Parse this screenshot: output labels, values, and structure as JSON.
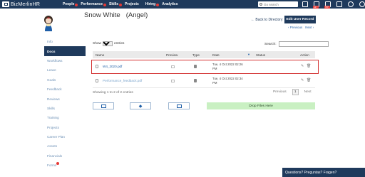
{
  "header": {
    "logo_text": "BizMerlinHR",
    "nav": [
      {
        "label": "People",
        "badge": true
      },
      {
        "label": "Performance",
        "badge": true
      },
      {
        "label": "Skills",
        "badge": true
      },
      {
        "label": "Projects",
        "badge": false
      },
      {
        "label": "Hiring",
        "badge": true
      },
      {
        "label": "Analytics",
        "badge": false
      }
    ],
    "search_placeholder": "Go search",
    "icons": [
      "mail-icon",
      "calendar-icon",
      "tasks-icon",
      "star-icon",
      "help-icon",
      "settings-icon",
      "user-icon"
    ],
    "badges": {
      "calendar": "11+",
      "tasks": "99+"
    }
  },
  "profile": {
    "name": "Snow White",
    "alias": "(Angel)",
    "back_link": "← Back to Directory",
    "edit_button": "Edit User Record",
    "prev": "‹ Previous",
    "next": "Next ›"
  },
  "sidebar": {
    "items": [
      {
        "label": "Info"
      },
      {
        "label": "Docs",
        "active": true
      },
      {
        "label": "Workflows"
      },
      {
        "label": "Leave"
      },
      {
        "label": "Goals"
      },
      {
        "label": "Feedback"
      },
      {
        "label": "Reviews"
      },
      {
        "label": "Skills"
      },
      {
        "label": "Training"
      },
      {
        "label": "Projects"
      },
      {
        "label": "Career Plan"
      },
      {
        "label": "Assets"
      },
      {
        "label": "Financials"
      },
      {
        "label": "Forms",
        "badge": true
      }
    ]
  },
  "docs": {
    "show_label": "Show",
    "entries_value": "10",
    "entries_label": "entries",
    "search_label": "Search:",
    "columns": [
      "Name",
      "Preview",
      "Type",
      "Date",
      "Status",
      "Action"
    ],
    "rows": [
      {
        "name": "W4_2020.pdf",
        "date_line1": "Tue, 4 Oct 2022 02:26",
        "date_line2": "PM"
      },
      {
        "name": "Performance_feedback.pdf",
        "date_line1": "Tue, 4 Oct 2022 02:34",
        "date_line2": "PM"
      }
    ],
    "showing": "Showing 1 to 2 of 2 entries",
    "previous": "Previous",
    "page": "1",
    "next": "Next",
    "drop_label": "Drop Files Here"
  },
  "chat": {
    "label": "Questions? Preguntas? Fragen?"
  },
  "colors": {
    "brand": "#1f3a5c",
    "link": "#1f5fa8",
    "highlight": "#d32f2f",
    "drop": "#c9f0c2"
  }
}
